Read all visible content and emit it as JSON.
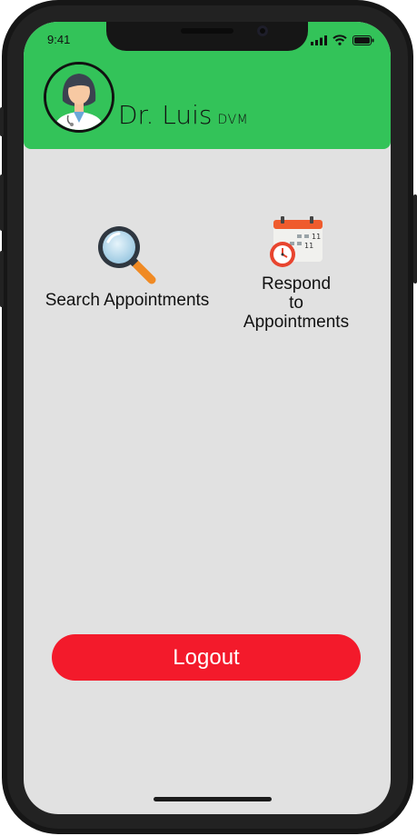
{
  "status_bar": {
    "time": "9:41"
  },
  "header": {
    "name": "Dr. Luis",
    "title": "DVM"
  },
  "menu": {
    "search": {
      "label": "Search Appointments",
      "icon": "magnifier-icon"
    },
    "respond": {
      "label_lines": [
        "Respond",
        "to",
        "Appointments"
      ],
      "icon": "calendar-clock-icon"
    }
  },
  "logout": {
    "label": "Logout"
  },
  "colors": {
    "header": "#33c359",
    "logout": "#f31a2b",
    "background": "#e1e1e1"
  }
}
